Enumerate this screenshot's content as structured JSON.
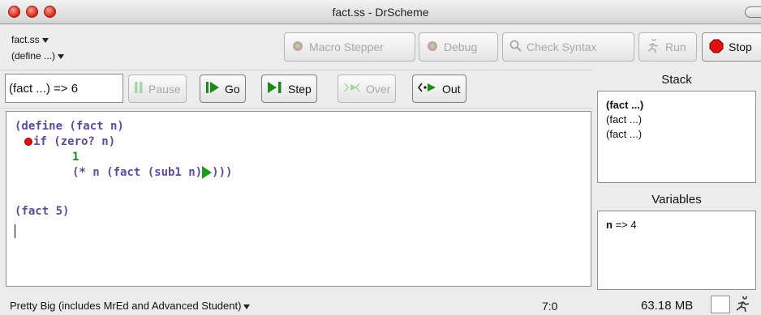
{
  "window": {
    "title": "fact.ss - DrScheme"
  },
  "toolbar": {
    "file_menu": "fact.ss",
    "define_menu": "(define ...)",
    "macro_stepper": "Macro Stepper",
    "debug": "Debug",
    "check_syntax": "Check Syntax",
    "run": "Run",
    "stop": "Stop"
  },
  "debugger": {
    "status": "(fact ...) => 6",
    "pause": "Pause",
    "go": "Go",
    "step": "Step",
    "over": "Over",
    "out": "Out"
  },
  "editor": {
    "lines": [
      "(define (fact n)",
      "if (zero? n)",
      "1",
      "(* n (fact (sub1 n)",
      "(fact 5)"
    ]
  },
  "stack": {
    "title": "Stack",
    "frames": [
      "(fact ...)",
      "(fact ...)",
      "(fact ...)"
    ]
  },
  "variables": {
    "title": "Variables",
    "items": [
      {
        "name": "n",
        "value": "=> 4"
      }
    ]
  },
  "status": {
    "language": "Pretty Big (includes MrEd and Advanced Student)",
    "position": "7:0",
    "memory": "63.18 MB"
  },
  "colors": {
    "keyword": "#5c4a9a",
    "number": "#1a8a1a",
    "breakpoint": "#e01010",
    "step_marker": "#1a9b1a",
    "stop_red": "#e01010"
  }
}
